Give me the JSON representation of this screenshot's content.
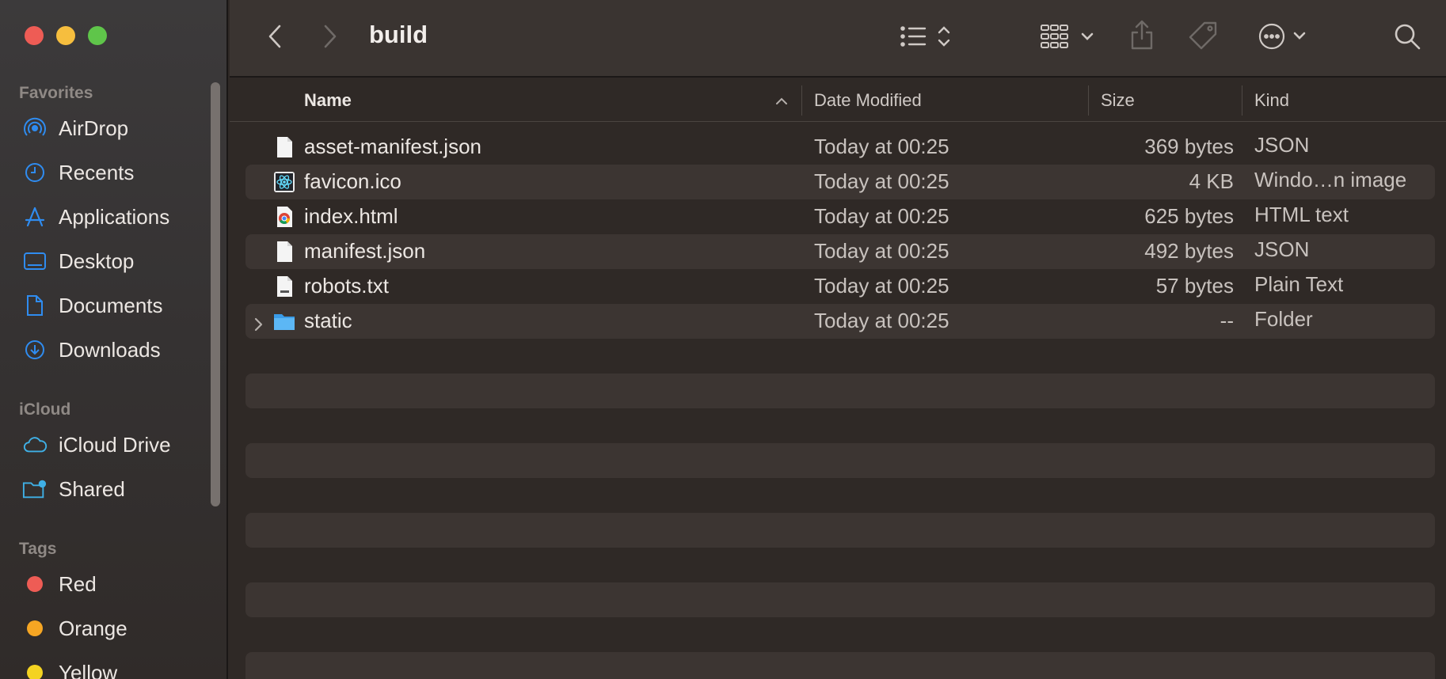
{
  "window": {
    "title": "build"
  },
  "sidebar": {
    "favorites_label": "Favorites",
    "favorites": [
      {
        "label": "AirDrop",
        "icon": "airdrop-icon"
      },
      {
        "label": "Recents",
        "icon": "clock-icon"
      },
      {
        "label": "Applications",
        "icon": "applications-icon"
      },
      {
        "label": "Desktop",
        "icon": "desktop-icon"
      },
      {
        "label": "Documents",
        "icon": "document-icon"
      },
      {
        "label": "Downloads",
        "icon": "download-icon"
      }
    ],
    "icloud_label": "iCloud",
    "icloud": [
      {
        "label": "iCloud Drive",
        "icon": "cloud-icon"
      },
      {
        "label": "Shared",
        "icon": "shared-folder-icon"
      }
    ],
    "tags_label": "Tags",
    "tags": [
      {
        "label": "Red",
        "color": "#ee5c55"
      },
      {
        "label": "Orange",
        "color": "#f6a623"
      },
      {
        "label": "Yellow",
        "color": "#f4d321"
      }
    ]
  },
  "columns": {
    "name": "Name",
    "date": "Date Modified",
    "size": "Size",
    "kind": "Kind"
  },
  "files": [
    {
      "name": "asset-manifest.json",
      "date": "Today at 00:25",
      "size": "369 bytes",
      "kind": "JSON",
      "icon": "json-file-icon"
    },
    {
      "name": "favicon.ico",
      "date": "Today at 00:25",
      "size": "4 KB",
      "kind": "Windo…n image",
      "icon": "react-icon-file-icon"
    },
    {
      "name": "index.html",
      "date": "Today at 00:25",
      "size": "625 bytes",
      "kind": "HTML text",
      "icon": "chrome-html-file-icon"
    },
    {
      "name": "manifest.json",
      "date": "Today at 00:25",
      "size": "492 bytes",
      "kind": "JSON",
      "icon": "json-file-icon"
    },
    {
      "name": "robots.txt",
      "date": "Today at 00:25",
      "size": "57 bytes",
      "kind": "Plain Text",
      "icon": "txt-file-icon"
    },
    {
      "name": "static",
      "date": "Today at 00:25",
      "size": "--",
      "kind": "Folder",
      "icon": "folder-icon"
    }
  ]
}
